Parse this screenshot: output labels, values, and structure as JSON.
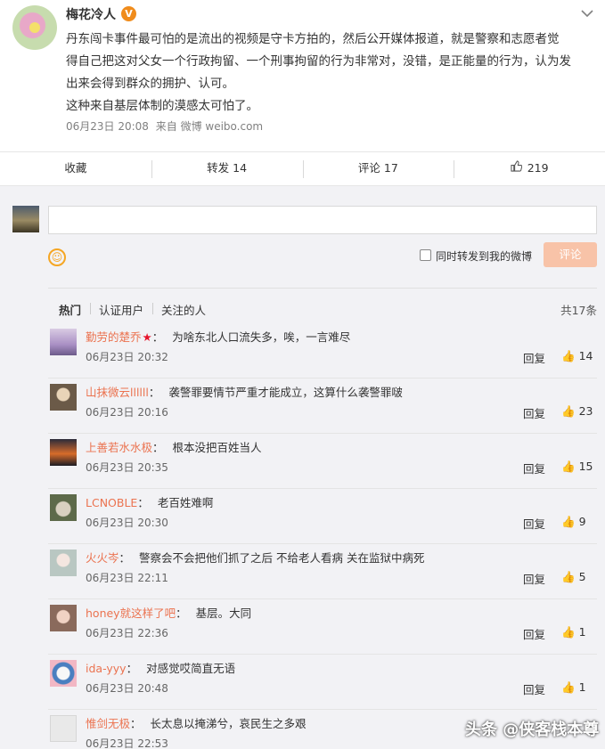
{
  "post": {
    "author": "梅花冷人",
    "verified_badge": "V",
    "text_lines": [
      "丹东闯卡事件最可怕的是流出的视频是守卡方拍的，然后公开媒体报道，就是警察和志愿者觉",
      "得自己把这对父女一个行政拘留、一个刑事拘留的行为非常对，没错，是正能量的行为，认为发",
      "出来会得到群众的拥护、认可。",
      "这种来自基层体制的漠感太可怕了。"
    ],
    "time": "06月23日 20:08",
    "source": "来自 微博 weibo.com"
  },
  "actions": {
    "favorite": "收藏",
    "repost": "转发 14",
    "comment": "评论 17",
    "like_count": "219"
  },
  "composer": {
    "placeholder": "",
    "forward_label": "同时转发到我的微博",
    "submit_label": "评论"
  },
  "comment_tabs": [
    "热门",
    "认证用户",
    "关注的人"
  ],
  "total_count": "共17条",
  "comments": [
    {
      "user": "勤劳的楚乔",
      "star": true,
      "text": "为啥东北人口流失多，唉，一言难尽",
      "time": "06月23日 20:32",
      "reply": "回复",
      "likes": "14"
    },
    {
      "user": "山抹微云llllll",
      "star": false,
      "text": "袭警罪要情节严重才能成立，这算什么袭警罪啵",
      "time": "06月23日 20:16",
      "reply": "回复",
      "likes": "23"
    },
    {
      "user": "上善若水水极",
      "star": false,
      "text": "根本没把百姓当人",
      "time": "06月23日 20:35",
      "reply": "回复",
      "likes": "15"
    },
    {
      "user": "LCNOBLE",
      "star": false,
      "text": "老百姓难啊",
      "time": "06月23日 20:30",
      "reply": "回复",
      "likes": "9"
    },
    {
      "user": "火火岑",
      "star": false,
      "text": "警察会不会把他们抓了之后 不给老人看病 关在监狱中病死",
      "time": "06月23日 22:11",
      "reply": "回复",
      "likes": "5"
    },
    {
      "user": "honey就这样了吧",
      "star": false,
      "text": "基层。大同",
      "time": "06月23日 22:36",
      "reply": "回复",
      "likes": "1"
    },
    {
      "user": "ida-yyy",
      "star": false,
      "text": "对感觉哎简直无语",
      "time": "06月23日 20:48",
      "reply": "回复",
      "likes": "1"
    },
    {
      "user": "惟剑无极",
      "star": false,
      "text": "长太息以掩涕兮，哀民生之多艰",
      "time": "06月23日 22:53",
      "reply": "",
      "likes": ""
    }
  ],
  "watermark": "头条 @侠客栈本尊",
  "colors": {
    "username": "#eb7350",
    "submit_disabled": "#f8c3a8",
    "badge": "#f08c1c"
  }
}
